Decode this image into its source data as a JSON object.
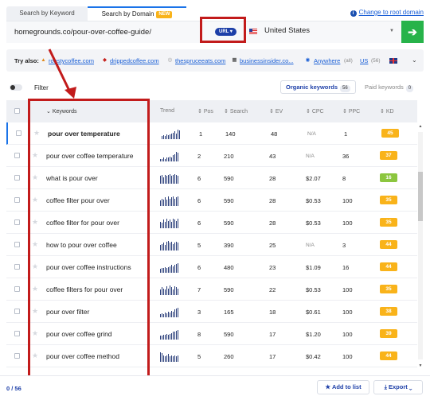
{
  "tabs": {
    "keyword": "Search by Keyword",
    "domain": "Search by Domain",
    "domain_badge": "NEW"
  },
  "root_link": "Change to root domain",
  "search": {
    "domain_value": "homegrounds.co/pour-over-coffee-guide/",
    "mode_badge": "URL",
    "country": "United States",
    "go_icon": "arrow-right-icon"
  },
  "try_also": {
    "label": "Try also:",
    "sites": [
      "roastycoffee.com",
      "drippedcoffee.com",
      "thespruceeats.com",
      "businessinsider.co..."
    ],
    "location": "Anywhere",
    "location_note": "(all)",
    "country_code": "US",
    "country_count": "(56)"
  },
  "filter": {
    "label": "Filter"
  },
  "result_tabs": {
    "organic": "Organic keywords",
    "organic_count": "56",
    "paid": "Paid keywords",
    "paid_count": "0"
  },
  "columns": {
    "keywords": "Keywords",
    "trend": "Trend",
    "pos": "Pos",
    "search": "Search",
    "ev": "EV",
    "cpc": "CPC",
    "ppc": "PPC",
    "kd": "KD"
  },
  "rows": [
    {
      "keyword": "pour over temperature",
      "pos": "1",
      "search": "140",
      "ev": "48",
      "cpc": "N/A",
      "ppc": "1",
      "kd": "45",
      "trend": [
        3,
        4,
        3,
        5,
        4,
        5,
        6,
        7,
        8,
        6,
        10,
        9
      ]
    },
    {
      "keyword": "pour over coffee temperature",
      "pos": "2",
      "search": "210",
      "ev": "43",
      "cpc": "N/A",
      "ppc": "36",
      "kd": "37",
      "trend": [
        2,
        2,
        3,
        2,
        3,
        3,
        4,
        3,
        5,
        6,
        8,
        7
      ]
    },
    {
      "keyword": "what is pour over",
      "pos": "6",
      "search": "590",
      "ev": "28",
      "cpc": "$2.07",
      "ppc": "8",
      "kd": "16",
      "trend": [
        8,
        9,
        7,
        9,
        8,
        9,
        10,
        8,
        9,
        10,
        9,
        8
      ]
    },
    {
      "keyword": "coffee filter pour over",
      "pos": "6",
      "search": "590",
      "ev": "28",
      "cpc": "$0.53",
      "ppc": "100",
      "kd": "35",
      "trend": [
        5,
        7,
        6,
        8,
        6,
        9,
        7,
        8,
        9,
        7,
        8,
        9
      ]
    },
    {
      "keyword": "coffee filter for pour over",
      "pos": "6",
      "search": "590",
      "ev": "28",
      "cpc": "$0.53",
      "ppc": "100",
      "kd": "35",
      "trend": [
        6,
        5,
        8,
        6,
        9,
        7,
        8,
        6,
        9,
        8,
        7,
        9
      ]
    },
    {
      "keyword": "how to pour over coffee",
      "pos": "5",
      "search": "390",
      "ev": "25",
      "cpc": "N/A",
      "ppc": "3",
      "kd": "44",
      "trend": [
        6,
        7,
        8,
        6,
        9,
        10,
        8,
        9,
        7,
        8,
        9,
        8
      ]
    },
    {
      "keyword": "pour over coffee instructions",
      "pos": "6",
      "search": "480",
      "ev": "23",
      "cpc": "$1.09",
      "ppc": "16",
      "kd": "44",
      "trend": [
        4,
        5,
        5,
        6,
        5,
        6,
        7,
        8,
        7,
        8,
        9,
        10
      ]
    },
    {
      "keyword": "coffee filters for pour over",
      "pos": "7",
      "search": "590",
      "ev": "22",
      "cpc": "$0.53",
      "ppc": "100",
      "kd": "35",
      "trend": [
        6,
        8,
        7,
        6,
        9,
        7,
        10,
        8,
        6,
        9,
        8,
        7
      ]
    },
    {
      "keyword": "pour over filter",
      "pos": "3",
      "search": "165",
      "ev": "18",
      "cpc": "$0.61",
      "ppc": "100",
      "kd": "38",
      "trend": [
        3,
        4,
        3,
        5,
        4,
        6,
        5,
        7,
        6,
        8,
        9,
        10
      ]
    },
    {
      "keyword": "pour over coffee grind",
      "pos": "8",
      "search": "590",
      "ev": "17",
      "cpc": "$1.20",
      "ppc": "100",
      "kd": "39",
      "trend": [
        4,
        4,
        5,
        5,
        6,
        5,
        6,
        7,
        8,
        8,
        9,
        10
      ]
    },
    {
      "keyword": "pour over coffee method",
      "pos": "5",
      "search": "260",
      "ev": "17",
      "cpc": "$0.42",
      "ppc": "100",
      "kd": "44",
      "trend": [
        10,
        9,
        7,
        6,
        7,
        8,
        6,
        7,
        6,
        7,
        6,
        7
      ]
    },
    {
      "keyword": "",
      "pos": "",
      "search": "",
      "ev": "",
      "cpc": "",
      "ppc": "",
      "kd": "",
      "trend": []
    }
  ],
  "footer": {
    "selected": "0 / 56",
    "add_to_list": "Add to list",
    "export": "Export"
  },
  "colors": {
    "accent": "#1d3fa8",
    "go": "#27b34a",
    "highlight": "#c21b1b",
    "kd_easy": "#8cc63f",
    "kd_medium": "#f9b31a"
  }
}
